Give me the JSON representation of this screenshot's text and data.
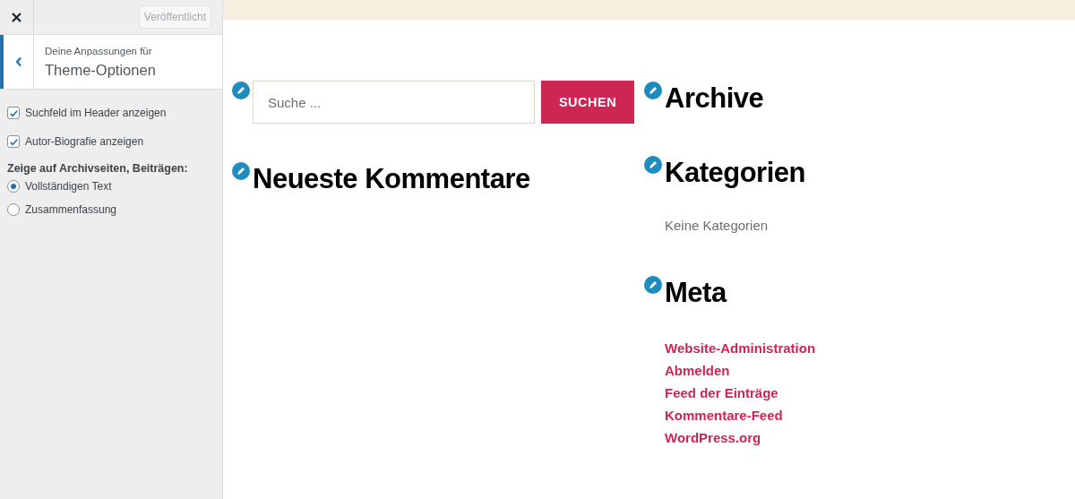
{
  "sidebar": {
    "publish_button": {
      "label": "Veröffentlicht",
      "disabled": true
    },
    "section": {
      "subtitle": "Deine Anpassungen für",
      "title": "Theme-Optionen"
    },
    "controls": [
      {
        "kind": "checkbox",
        "label": "Suchfeld im Header anzeigen",
        "checked": true
      },
      {
        "kind": "checkbox",
        "label": "Autor-Biografie anzeigen",
        "checked": true
      },
      {
        "kind": "heading",
        "label": "Zeige auf Archivseiten, Beiträgen:"
      },
      {
        "kind": "radio",
        "label": "Vollständigen Text",
        "selected": true
      },
      {
        "kind": "radio",
        "label": "Zusammenfassung",
        "selected": false
      }
    ]
  },
  "preview": {
    "columns": [
      [
        {
          "kind": "search",
          "placeholder": "Suche ...",
          "button": "SUCHEN"
        },
        {
          "kind": "widget",
          "title": "Neueste Kommentare"
        }
      ],
      [
        {
          "kind": "widget",
          "title": "Archive"
        },
        {
          "kind": "widget",
          "title": "Kategorien",
          "text": "Keine Kategorien"
        },
        {
          "kind": "widget",
          "title": "Meta",
          "links": [
            "Website-Administration",
            "Abmelden",
            "Feed der Einträge",
            "Kommentare-Feed",
            "WordPress.org"
          ]
        }
      ]
    ]
  }
}
